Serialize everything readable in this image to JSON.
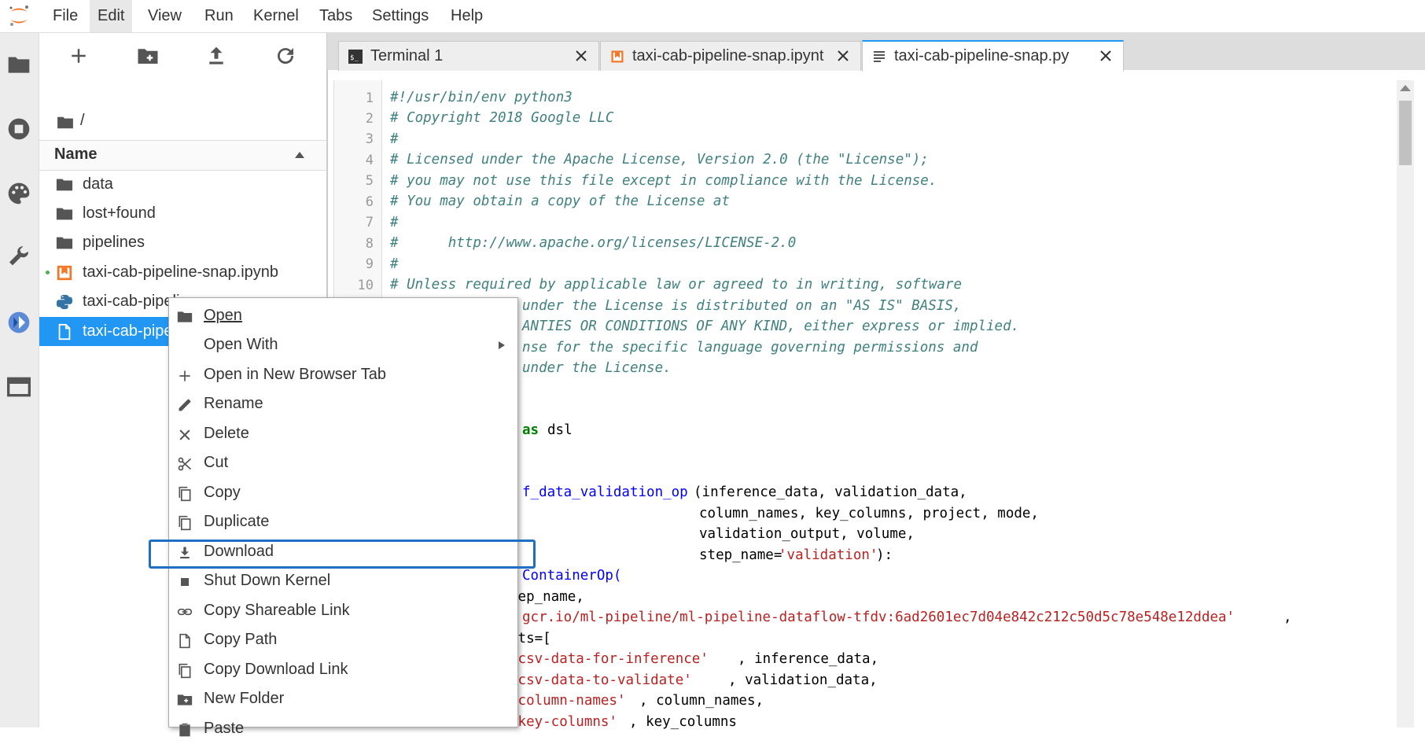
{
  "menubar": {
    "items": [
      {
        "label": "File"
      },
      {
        "label": "Edit"
      },
      {
        "label": "View"
      },
      {
        "label": "Run"
      },
      {
        "label": "Kernel"
      },
      {
        "label": "Tabs"
      },
      {
        "label": "Settings"
      },
      {
        "label": "Help"
      }
    ],
    "active_item": "Edit"
  },
  "siderail": {
    "icons": [
      "folder-icon",
      "stop-circle-icon",
      "palette-icon",
      "wrench-icon",
      "kubeflow-icon",
      "tabs-icon"
    ]
  },
  "filebrowser": {
    "toolbar_icons": [
      "new-launcher-icon",
      "new-folder-icon",
      "upload-icon",
      "refresh-icon"
    ],
    "breadcrumb": "/",
    "column_header": "Name",
    "files": [
      {
        "name": "data",
        "icon": "folder-icon",
        "running": false,
        "selected": false
      },
      {
        "name": "lost+found",
        "icon": "folder-icon",
        "running": false,
        "selected": false
      },
      {
        "name": "pipelines",
        "icon": "folder-icon",
        "running": false,
        "selected": false
      },
      {
        "name": "taxi-cab-pipeline-snap.ipynb",
        "icon": "notebook-icon",
        "running": true,
        "selected": false
      },
      {
        "name": "taxi-cab-pipeline-snap.py",
        "icon": "python-icon",
        "running": false,
        "selected": false
      },
      {
        "name": "taxi-cab-pipeline-snap.py",
        "display": "taxi-cab-pipeli",
        "icon": "text-file-icon",
        "running": false,
        "selected": true
      }
    ]
  },
  "tabs": [
    {
      "label": "Terminal 1",
      "icon": "terminal-icon",
      "current": false
    },
    {
      "label": "taxi-cab-pipeline-snap.ipynb",
      "display": "taxi-cab-pipeline-snap.ipynt",
      "icon": "notebook-icon",
      "current": false
    },
    {
      "label": "taxi-cab-pipeline-snap.py",
      "icon": "text-file-icon",
      "current": true
    }
  ],
  "editor": {
    "line_numbers": [
      "1",
      "2",
      "3",
      "4",
      "5",
      "6",
      "7",
      "8",
      "9",
      "10"
    ],
    "lines": [
      "#!/usr/bin/env python3",
      "# Copyright 2018 Google LLC",
      "#",
      "# Licensed under the Apache License, Version 2.0 (the \"License\");",
      "# you may not use this file except in compliance with the License.",
      "# You may obtain a copy of the License at",
      "#",
      "#      http://www.apache.org/licenses/LICENSE-2.0",
      "#",
      "# Unless required by applicable law or agreed to in writing, software",
      "under the License is distributed on an \"AS IS\" BASIS,",
      "ANTIES OR CONDITIONS OF ANY KIND, either express or implied.",
      "nse for the specific language governing permissions and",
      "under the License.",
      "as",
      "dsl",
      "f_data_validation_op",
      "(inference_data, validation_data,",
      "column_names, key_columns, project, mode,",
      "validation_output, volume,",
      "step_name=",
      "'validation'",
      "):",
      "ContainerOp(",
      "tep_name,",
      "gcr.io/ml-pipeline/ml-pipeline-dataflow-tfdv:6ad2601ec7d04e842c212c50d5c78e548e12ddea'",
      ",",
      "nts=[",
      "-csv-data-for-inference'",
      ", inference_data,",
      "-csv-data-to-validate'",
      ", validation_data,",
      "-column-names'",
      ", column_names,",
      "-key-columns'",
      ", key_columns"
    ]
  },
  "context_menu": {
    "items": [
      {
        "label": "Open",
        "icon": "folder-icon",
        "submenu": false
      },
      {
        "label": "Open With",
        "icon": "",
        "submenu": true
      },
      {
        "label": "Open in New Browser Tab",
        "icon": "plus-icon",
        "submenu": false
      },
      {
        "label": "Rename",
        "icon": "pencil-icon",
        "submenu": false
      },
      {
        "label": "Delete",
        "icon": "close-icon",
        "submenu": false
      },
      {
        "label": "Cut",
        "icon": "scissors-icon",
        "submenu": false
      },
      {
        "label": "Copy",
        "icon": "copy-icon",
        "submenu": false
      },
      {
        "label": "Duplicate",
        "icon": "copy-icon",
        "submenu": false
      },
      {
        "label": "Download",
        "icon": "download-icon",
        "submenu": false,
        "highlighted": true
      },
      {
        "label": "Shut Down Kernel",
        "icon": "stop-square-icon",
        "submenu": false
      },
      {
        "label": "Copy Shareable Link",
        "icon": "link-icon",
        "submenu": false
      },
      {
        "label": "Copy Path",
        "icon": "file-icon",
        "submenu": false
      },
      {
        "label": "Copy Download Link",
        "icon": "copy-icon",
        "submenu": false
      },
      {
        "label": "New Folder",
        "icon": "new-folder-icon",
        "submenu": false
      },
      {
        "label": "Paste",
        "icon": "paste-icon",
        "submenu": false
      }
    ]
  },
  "colors": {
    "accent": "#2196f3",
    "highlight_box": "#1f6fc5",
    "jupyter_orange": "#f37726"
  }
}
